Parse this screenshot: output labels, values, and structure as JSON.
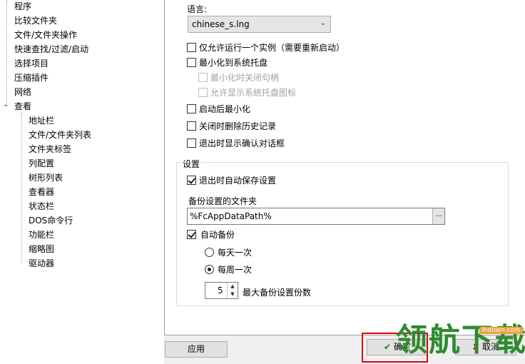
{
  "tree": {
    "items": [
      {
        "label": "程序"
      },
      {
        "label": "比较文件夹"
      },
      {
        "label": "文件/文件夹操作"
      },
      {
        "label": "快速查找/过滤/启动"
      },
      {
        "label": "选择项目"
      },
      {
        "label": "压缩插件"
      },
      {
        "label": "网络"
      },
      {
        "label": "查看"
      },
      {
        "label": "地址栏"
      },
      {
        "label": "文件/文件夹列表"
      },
      {
        "label": "文件夹标签"
      },
      {
        "label": "列配置"
      },
      {
        "label": "树形列表"
      },
      {
        "label": "查看器"
      },
      {
        "label": "状态栏"
      },
      {
        "label": "DOS命令行"
      },
      {
        "label": "功能栏"
      },
      {
        "label": "缩略图"
      },
      {
        "label": "驱动器"
      }
    ],
    "expander_symbol": "⌄"
  },
  "language": {
    "label": "语言:",
    "value": "chinese_s.lng"
  },
  "options": {
    "single_instance": {
      "label": "仅允许运行一个实例（需要重新启动）",
      "checked": false
    },
    "minimize_to_tray": {
      "label": "最小化到系统托盘",
      "checked": false
    },
    "close_handle_on_minimize": {
      "label": "最小化时关闭句柄",
      "checked": false,
      "disabled": true
    },
    "show_tray_icon": {
      "label": "允许显示系统托盘图标",
      "checked": false,
      "disabled": true
    },
    "minimize_on_start": {
      "label": "启动后最小化",
      "checked": false
    },
    "clear_history_on_close": {
      "label": "关闭时删除历史记录",
      "checked": false
    },
    "confirm_on_exit": {
      "label": "退出时显示确认对话框",
      "checked": false
    }
  },
  "settings_group": {
    "title": "设置",
    "auto_save_on_exit": {
      "label": "退出时自动保存设置",
      "checked": true
    },
    "backup_folder_label": "备份设置的文件夹",
    "backup_folder_value": "%FcAppDataPath%",
    "browse_label": "...",
    "auto_backup": {
      "label": "自动备份",
      "checked": true
    },
    "daily": {
      "label": "每天一次",
      "selected": false
    },
    "weekly": {
      "label": "每周一次",
      "selected": true
    },
    "max_backups_value": "5",
    "max_backups_label": "最大备份设置份数"
  },
  "buttons": {
    "apply": "应用",
    "ok": "确定",
    "cancel": "取消"
  },
  "watermark": {
    "text": "领航下载",
    "site": "lhdown.com"
  }
}
